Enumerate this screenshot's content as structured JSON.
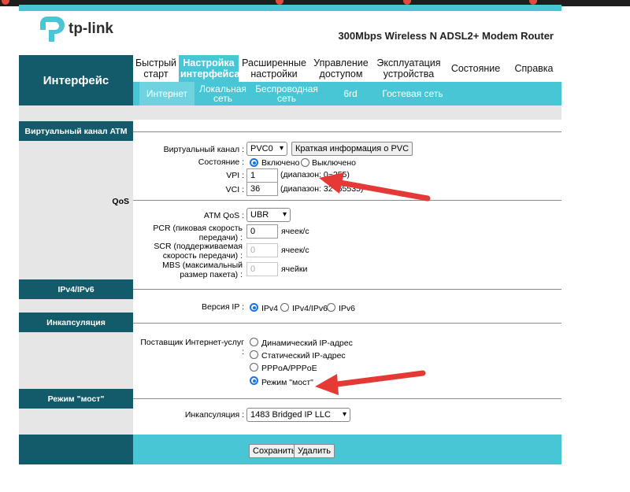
{
  "header": {
    "logo_text": "tp-link",
    "model": "300Mbps Wireless N ADSL2+ Modem Router"
  },
  "sidebar": {
    "title": "Интерфейс"
  },
  "menu": [
    {
      "label": "Быстрый старт"
    },
    {
      "label": "Настройка интерфейса",
      "active": true
    },
    {
      "label": "Расширенные настройки"
    },
    {
      "label": "Управление доступом"
    },
    {
      "label": "Эксплуатация устройства"
    },
    {
      "label": "Состояние"
    },
    {
      "label": "Справка"
    }
  ],
  "submenu": [
    {
      "label": "Интернет",
      "active": true
    },
    {
      "label": "Локальная сеть"
    },
    {
      "label": "Беспроводная сеть"
    },
    {
      "label": "6rd"
    },
    {
      "label": "Гостевая сеть"
    }
  ],
  "sections": {
    "atm": "Виртуальный канал ATM",
    "qos": "QoS",
    "ip": "IPv4/IPv6",
    "encap": "Инкапсуляция",
    "bridge": "Режим \"мост\""
  },
  "atm": {
    "vc_label": "Виртуальный канал :",
    "vc_value": "PVC0",
    "summary_button": "Краткая информация о PVC",
    "state_label": "Состояние :",
    "state_on": "Включено",
    "state_off": "Выключено",
    "vpi_label": "VPI :",
    "vpi_value": "1",
    "vpi_range": "(диапазон: 0~255)",
    "vci_label": "VCI :",
    "vci_value": "36",
    "vci_range": "(диапазон: 32~65535)"
  },
  "qos": {
    "atm_qos_label": "ATM QoS :",
    "atm_qos_value": "UBR",
    "pcr_label": "PCR (пиковая скорость передачи) :",
    "pcr_value": "0",
    "pcr_unit": "ячеек/с",
    "scr_label": "SCR (поддерживаемая скорость передачи) :",
    "scr_value": "0",
    "scr_unit": "ячеек/с",
    "mbs_label": "MBS (максимальный размер пакета) :",
    "mbs_value": "0",
    "mbs_unit": "ячейки"
  },
  "ip": {
    "version_label": "Версия IP :",
    "options": [
      "IPv4",
      "IPv4/IPv6",
      "IPv6"
    ],
    "selected": "IPv4"
  },
  "encap": {
    "isp_label": "Поставщик Интернет-услуг :",
    "options": [
      "Динамический IP-адрес",
      "Статический IP-адрес",
      "PPPoA/PPPoE",
      "Режим \"мост\""
    ],
    "selected": "Режим \"мост\""
  },
  "bridge": {
    "encap_label": "Инкапсуляция :",
    "encap_value": "1483 Bridged IP LLC"
  },
  "footer": {
    "save": "Сохранить",
    "delete": "Удалить"
  },
  "colors": {
    "teal_dark": "#135a6a",
    "cyan": "#48c6d6",
    "arrow": "#e53935",
    "radio": "#1a73e8"
  }
}
